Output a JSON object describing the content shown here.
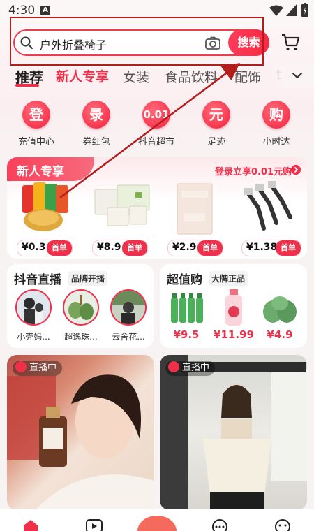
{
  "status_bar": {
    "time": "4:30",
    "badge": "A"
  },
  "search": {
    "query": "户外折叠椅子",
    "button_label": "搜索"
  },
  "tabs": [
    "推荐",
    "新人专享",
    "女装",
    "食品饮料",
    "配饰",
    "t"
  ],
  "shortcuts": [
    {
      "glyph": "登",
      "label": "充值中心"
    },
    {
      "glyph": "录",
      "label": "券红包"
    },
    {
      "glyph": "0.01",
      "label": "抖音超市"
    },
    {
      "glyph": "元",
      "label": "足迹"
    },
    {
      "glyph": "购",
      "label": "小时达"
    }
  ],
  "new_user": {
    "title": "新人专享",
    "promo": "登录立享0.01元购",
    "products": [
      {
        "price": "¥0.3",
        "badge": "首单"
      },
      {
        "price": "¥8.9",
        "badge": "首单"
      },
      {
        "price": "¥2.9",
        "badge": "首单"
      },
      {
        "price": "¥1.38",
        "badge": "首单"
      }
    ]
  },
  "live": {
    "title": "抖音直播",
    "tag": "品牌开播",
    "streamers": [
      "小壳妈...",
      "超逸珠...",
      "云舍花..."
    ]
  },
  "deals": {
    "title": "超值购",
    "tag": "大牌正品",
    "prices": [
      "¥9.5",
      "¥11.99",
      "¥4.9"
    ]
  },
  "videos": [
    {
      "badge": "直播中"
    },
    {
      "badge": "直播中"
    }
  ],
  "colors": {
    "accent": "#f0304a",
    "annotation": "#b51c1c"
  }
}
